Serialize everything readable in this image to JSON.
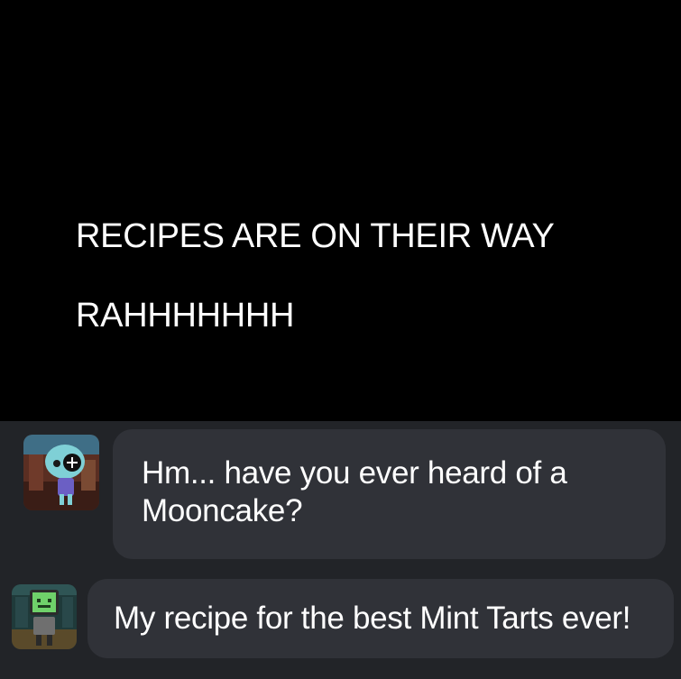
{
  "caption": {
    "line1": "RECIPES ARE ON THEIR WAY",
    "line2": "RAHHHHHHH"
  },
  "messages": [
    {
      "avatar_icon": "teal-character-avatar-icon",
      "text_line1": "Hm... have you ever heard of a",
      "text_line2": "Mooncake?"
    },
    {
      "avatar_icon": "tv-head-character-avatar-icon",
      "text": "My recipe for the best Mint Tarts ever!"
    }
  ],
  "colors": {
    "background": "#000000",
    "chat_panel": "#222428",
    "bubble": "#303238",
    "text": "#ffffff"
  }
}
